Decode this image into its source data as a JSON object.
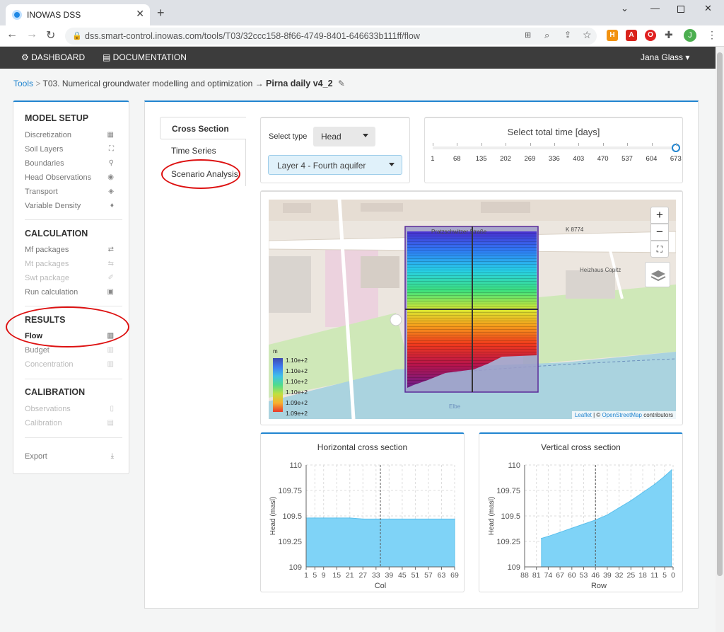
{
  "browser": {
    "tab_title": "INOWAS DSS",
    "url": "dss.smart-control.inowas.com/tools/T03/32ccc158-8f66-4749-8401-646633b111ff/flow",
    "avatar_letter": "J"
  },
  "header": {
    "dashboard": "DASHBOARD",
    "documentation": "DOCUMENTATION",
    "user": "Jana Glass"
  },
  "breadcrumb": {
    "tools": "Tools",
    "sep1": ">",
    "tool": "T03. Numerical groundwater modelling and optimization",
    "sep2": "→",
    "model": "Pirna daily v4_2"
  },
  "sidebar": {
    "model_setup": {
      "title": "MODEL SETUP",
      "items": [
        "Discretization",
        "Soil Layers",
        "Boundaries",
        "Head Observations",
        "Transport",
        "Variable Density"
      ]
    },
    "calculation": {
      "title": "CALCULATION",
      "items": [
        "Mf packages",
        "Mt packages",
        "Swt package",
        "Run calculation"
      ]
    },
    "results": {
      "title": "RESULTS",
      "items": [
        "Flow",
        "Budget",
        "Concentration"
      ]
    },
    "calibration": {
      "title": "CALIBRATION",
      "items": [
        "Observations",
        "Calibration"
      ]
    },
    "export": "Export"
  },
  "tabs": [
    "Cross Section",
    "Time Series",
    "Scenario Analysis"
  ],
  "select": {
    "type_label": "Select type",
    "type_value": "Head",
    "layer_value": "Layer 4 - Fourth aquifer"
  },
  "time": {
    "title": "Select total time [days]",
    "ticks": [
      "1",
      "68",
      "135",
      "202",
      "269",
      "336",
      "403",
      "470",
      "537",
      "604",
      "673"
    ],
    "selected_fraction": 1.0
  },
  "map": {
    "street1": "Pratzschwitzer Straße",
    "road": "K 8774",
    "poi": "Heizhaus Copitz",
    "river": "Elbe",
    "legend_unit": "m",
    "legend_values": [
      "1.10e+2",
      "1.10e+2",
      "1.10e+2",
      "1.10e+2",
      "1.09e+2",
      "1.09e+2"
    ],
    "attribution_leaflet": "Leaflet",
    "attribution_sep": " | © ",
    "attribution_osm": "OpenStreetMap",
    "attribution_rest": " contributors",
    "zoom_in": "+",
    "zoom_out": "−"
  },
  "chart_data": [
    {
      "type": "area",
      "title": "Horizontal cross section",
      "xlabel": "Col",
      "ylabel": "Head (masl)",
      "ylim": [
        109,
        110
      ],
      "yticks": [
        "109",
        "109.25",
        "109.5",
        "109.75",
        "110"
      ],
      "xticks": [
        "1",
        "5",
        "9",
        "15",
        "21",
        "27",
        "33",
        "39",
        "45",
        "51",
        "57",
        "63",
        "69"
      ],
      "x": [
        1,
        5,
        9,
        15,
        21,
        27,
        33,
        39,
        45,
        51,
        57,
        63,
        69
      ],
      "values": [
        109.48,
        109.48,
        109.48,
        109.48,
        109.48,
        109.47,
        109.47,
        109.47,
        109.47,
        109.47,
        109.47,
        109.47,
        109.47
      ],
      "marker": 35,
      "color": "#7fd3f7"
    },
    {
      "type": "area",
      "title": "Vertical cross section",
      "xlabel": "Row",
      "ylabel": "Head (masl)",
      "ylim": [
        109,
        110
      ],
      "yticks": [
        "109",
        "109.25",
        "109.5",
        "109.75",
        "110"
      ],
      "xticks": [
        "88",
        "81",
        "74",
        "67",
        "60",
        "53",
        "46",
        "39",
        "32",
        "25",
        "18",
        "11",
        "5",
        "0"
      ],
      "x": [
        78,
        74,
        67,
        60,
        53,
        46,
        39,
        32,
        25,
        18,
        11,
        5,
        1
      ],
      "values": [
        109.28,
        109.3,
        109.34,
        109.38,
        109.42,
        109.46,
        109.51,
        109.58,
        109.65,
        109.73,
        109.81,
        109.89,
        109.95
      ],
      "marker": 46,
      "color": "#7fd3f7"
    }
  ]
}
